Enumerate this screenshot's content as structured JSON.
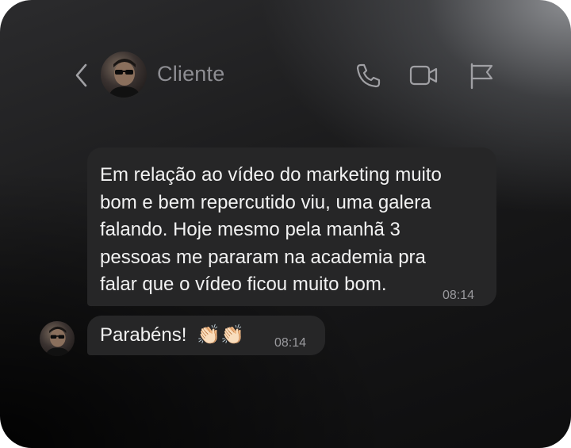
{
  "header": {
    "contact_name": "Cliente",
    "back_icon": "chevron-left-icon",
    "call_icon": "phone-icon",
    "video_icon": "video-camera-icon",
    "flag_icon": "flag-icon"
  },
  "messages": [
    {
      "text": "Em relação ao vídeo do marketing muito\nbom e bem repercutido viu, uma galera\nfalando. Hoje mesmo pela manhã 3\npessoas me pararam na academia pra\nfalar que o vídeo ficou muito bom.",
      "time": "08:14"
    },
    {
      "text": "Parabéns!",
      "emoji": "👏🏻👏🏻",
      "time": "08:14"
    }
  ],
  "colors": {
    "bubble": "#262627",
    "name": "#8e8e93",
    "icon": "#a0a0a4",
    "time": "#9a9a9e"
  }
}
